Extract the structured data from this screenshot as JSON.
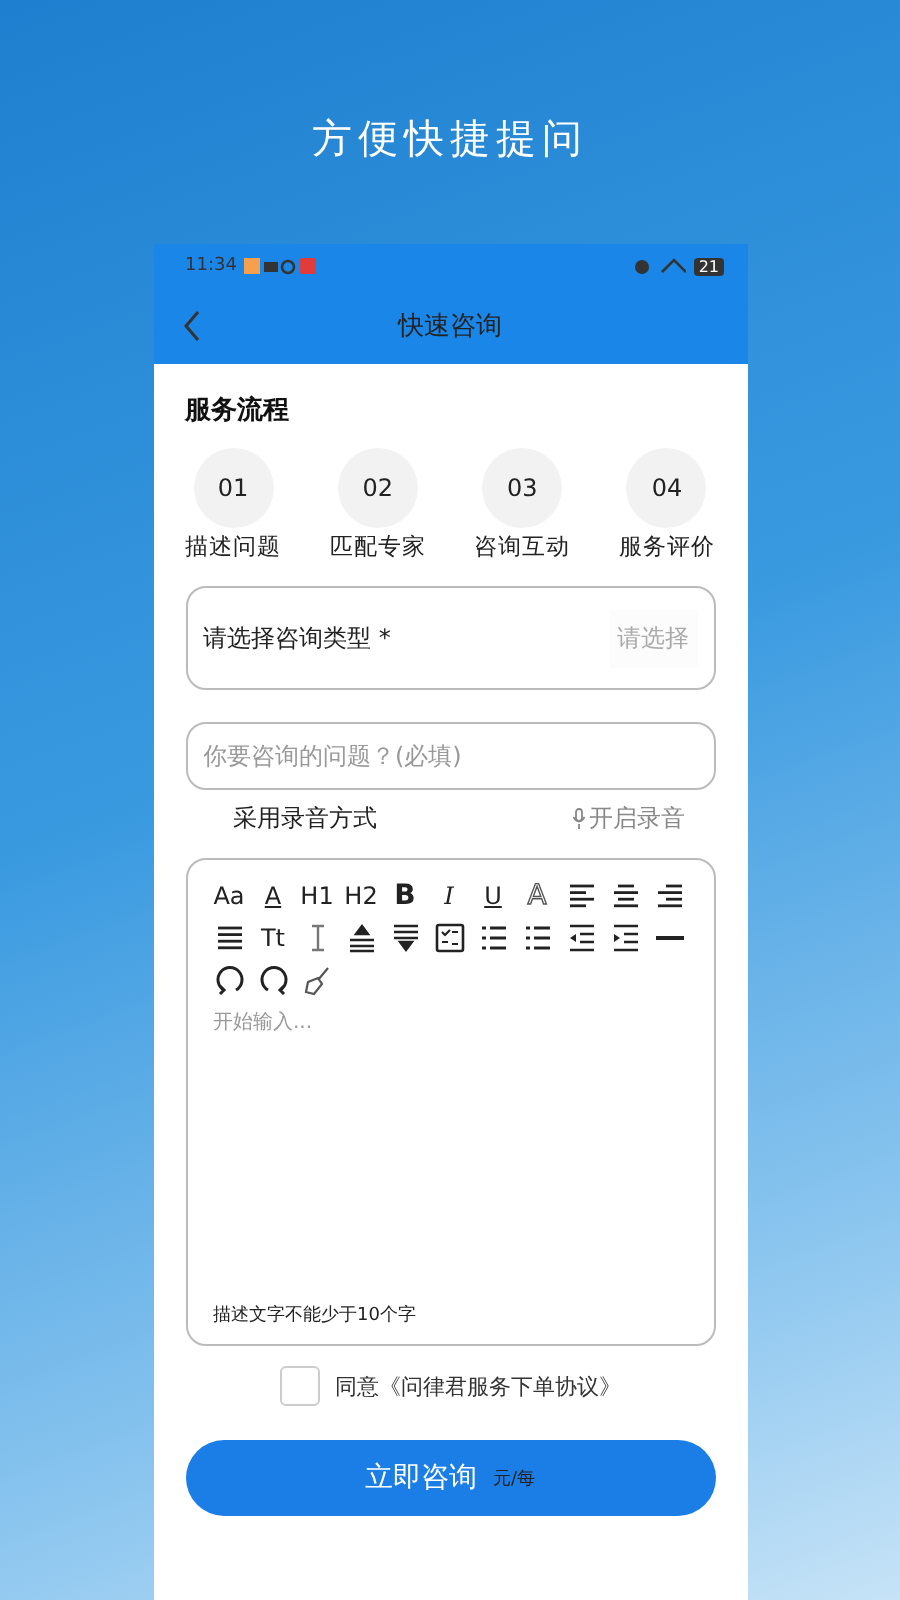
{
  "headline": "方便快捷提问",
  "status_bar": {
    "time": "11:34",
    "battery": "21"
  },
  "header": {
    "title": "快速咨询"
  },
  "process": {
    "title": "服务流程",
    "steps": [
      {
        "number": "01",
        "label": "描述问题"
      },
      {
        "number": "02",
        "label": "匹配专家"
      },
      {
        "number": "03",
        "label": "咨询互动"
      },
      {
        "number": "04",
        "label": "服务评价"
      }
    ]
  },
  "type_select": {
    "label": "请选择咨询类型 *",
    "placeholder": "请选择"
  },
  "question": {
    "placeholder": "你要咨询的问题？(必填)"
  },
  "voice": {
    "label": "采用录音方式",
    "button": "开启录音"
  },
  "editor": {
    "toolbar": [
      {
        "kind": "text",
        "label": "Aa"
      },
      {
        "kind": "text",
        "label": "A"
      },
      {
        "kind": "text",
        "label": "H1"
      },
      {
        "kind": "text",
        "label": "H2"
      },
      {
        "kind": "text",
        "label": "B"
      },
      {
        "kind": "text",
        "label": "I"
      },
      {
        "kind": "text",
        "label": "U"
      },
      {
        "kind": "text",
        "label": "A"
      },
      {
        "kind": "icon"
      },
      {
        "kind": "icon"
      },
      {
        "kind": "icon"
      },
      {
        "kind": "icon"
      },
      {
        "kind": "text",
        "label": "Tt"
      },
      {
        "kind": "icon"
      },
      {
        "kind": "icon"
      },
      {
        "kind": "icon"
      },
      {
        "kind": "icon"
      },
      {
        "kind": "icon"
      },
      {
        "kind": "icon"
      },
      {
        "kind": "icon"
      },
      {
        "kind": "icon"
      },
      {
        "kind": "icon"
      },
      {
        "kind": "icon"
      },
      {
        "kind": "icon"
      },
      {
        "kind": "icon"
      }
    ],
    "placeholder": "开始输入...",
    "hint": "描述文字不能少于10个字"
  },
  "agreement": {
    "checked": false,
    "text": "同意《问律君服务下单协议》"
  },
  "submit": {
    "label": "立即咨询",
    "price_unit": "元/每"
  }
}
